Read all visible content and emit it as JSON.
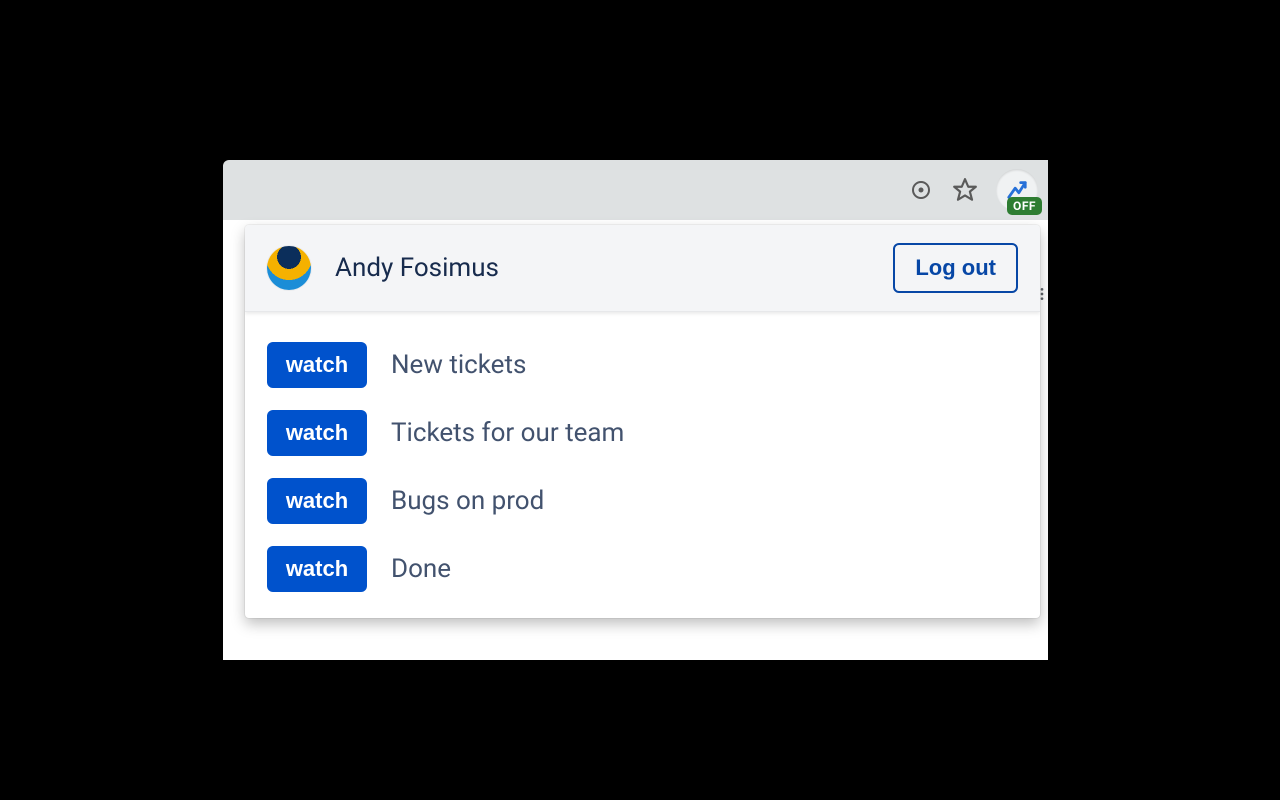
{
  "toolbar": {
    "extension_badge": "OFF"
  },
  "popup": {
    "user_name": "Andy Fosimus",
    "logout_label": "Log out",
    "watch_label": "watch",
    "filters": [
      {
        "label": "New tickets"
      },
      {
        "label": "Tickets for our team"
      },
      {
        "label": "Bugs on prod"
      },
      {
        "label": "Done"
      }
    ]
  }
}
